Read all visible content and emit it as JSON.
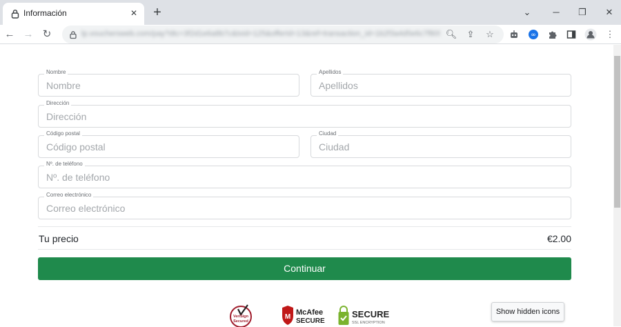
{
  "browser": {
    "tab": {
      "title": "Información",
      "icon": "lock-icon"
    },
    "address_url": "lp.vouchersweb.com/pay?dtc=3f2d1e6a8b7c&txid=125&offerId=13&ref=transaction_id=1b2f3a4d5e6c7f8091a2b3",
    "colors": {
      "tabstrip": "#dee1e6",
      "omnibox": "#f1f3f4"
    }
  },
  "form": {
    "fields": {
      "nombre": {
        "label": "Nombre",
        "placeholder": "Nombre"
      },
      "apellidos": {
        "label": "Apellidos",
        "placeholder": "Apellidos"
      },
      "direccion": {
        "label": "Dirección",
        "placeholder": "Dirección"
      },
      "codigo_postal": {
        "label": "Código postal",
        "placeholder": "Código postal"
      },
      "ciudad": {
        "label": "Ciudad",
        "placeholder": "Ciudad"
      },
      "telefono": {
        "label": "Nº. de teléfono",
        "placeholder": "Nº. de teléfono"
      },
      "correo": {
        "label": "Correo electrónico",
        "placeholder": "Correo electrónico"
      }
    }
  },
  "price": {
    "label": "Tu precio",
    "value": "€2.00"
  },
  "continue_label": "Continuar",
  "badges": {
    "verisign": {
      "line1": "VeriSign",
      "line2": "Secured"
    },
    "mcafee": {
      "brand": "McAfee",
      "sub": "SECURE"
    },
    "ssl": {
      "title": "SECURE",
      "sub": "SSL ENCRYPTION"
    }
  },
  "tooltip": "Show hidden icons",
  "colors": {
    "accent": "#1f8a4c",
    "verisign": "#a01c2c",
    "mcafee": "#c01818",
    "ssl": "#7ab32e"
  }
}
